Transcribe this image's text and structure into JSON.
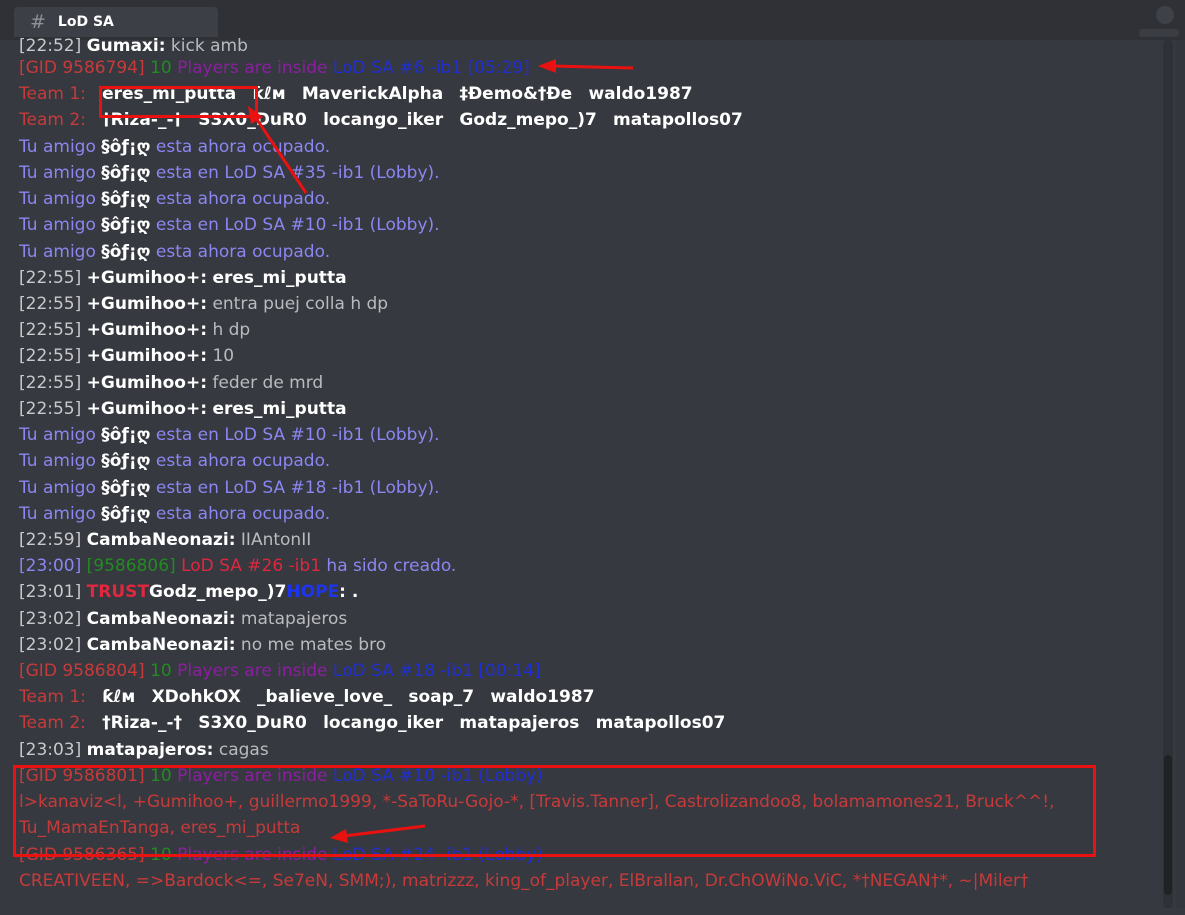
{
  "tab": {
    "icon": "hash-icon",
    "label": "LoD SA"
  },
  "chat": {
    "line0": {
      "time": "[22:52]",
      "user": "Gumaxi:",
      "text": "kick amb"
    },
    "gid1": {
      "gid": "[GID 9586794]",
      "count": "10",
      "status": "Players are inside",
      "game": "LoD SA #6 -ib1",
      "time": "[05:29]"
    },
    "team1a": {
      "label": "Team 1:",
      "players": [
        "eres_mi_putta",
        "ƙℓм",
        "MaverickAlpha",
        "‡Ðemo&†Ðe",
        "waldo1987"
      ]
    },
    "team2a": {
      "label": "Team 2:",
      "players": [
        "†Riza-_-†",
        "S3X0_DuR0",
        "locango_iker",
        "Godz_mepo_)7",
        "matapollos07"
      ]
    },
    "friend": "§ôƒ¡ღ",
    "friend_prefix": "Tu amigo",
    "busy_text": "esta ahora ocupado.",
    "lobby35": "esta en LoD SA #35 -ib1 (Lobby).",
    "lobby10": "esta en LoD SA #10 -ib1 (Lobby).",
    "lobby18": "esta en LoD SA #18 -ib1 (Lobby).",
    "msgs1": [
      {
        "time": "[22:55]",
        "user": "+Gumihoo+:",
        "text": "eres_mi_putta",
        "bold": true
      },
      {
        "time": "[22:55]",
        "user": "+Gumihoo+:",
        "text": "entra puej colla h dp"
      },
      {
        "time": "[22:55]",
        "user": "+Gumihoo+:",
        "text": "h dp"
      },
      {
        "time": "[22:55]",
        "user": "+Gumihoo+:",
        "text": "10"
      },
      {
        "time": "[22:55]",
        "user": "+Gumihoo+:",
        "text": "feder de mrd"
      },
      {
        "time": "[22:55]",
        "user": "+Gumihoo+:",
        "text": "eres_mi_putta",
        "bold": true
      }
    ],
    "m2259": {
      "time": "[22:59]",
      "user": "CambaNeonazi:",
      "text": "IIAntonII"
    },
    "created": {
      "time": "[23:00]",
      "gid": "[9586806]",
      "game": "LoD SA #26 -ib1",
      "text": "ha sido creado."
    },
    "trust": {
      "time": "[23:01]",
      "pre": "TRUST",
      "name": "Godz_mepo_)7",
      "post": "HOPE",
      "text": ": ."
    },
    "m2302a": {
      "time": "[23:02]",
      "user": "CambaNeonazi:",
      "text": "matapajeros"
    },
    "m2302b": {
      "time": "[23:02]",
      "user": "CambaNeonazi:",
      "text": "no me mates bro"
    },
    "gid2": {
      "gid": "[GID 9586804]",
      "count": "10",
      "status": "Players are inside",
      "game": "LoD SA #18 -ib1",
      "time": "[00:14]"
    },
    "team1b": {
      "label": "Team 1:",
      "players": [
        "ƙℓм",
        "XDohkOX",
        "_balieve_love_",
        "soap_7",
        "waldo1987"
      ]
    },
    "team2b": {
      "label": "Team 2:",
      "players": [
        "†Riza-_-†",
        "S3X0_DuR0",
        "locango_iker",
        "matapajeros",
        "matapollos07"
      ]
    },
    "m2303": {
      "time": "[23:03]",
      "user": "matapajeros:",
      "text": "cagas"
    },
    "gid3": {
      "gid": "[GID 9586801]",
      "count": "10",
      "status": "Players are inside",
      "game": "LoD SA #10 -ib1 (Lobby)"
    },
    "list3a": "l>kanaviz<l, +Gumihoo+, guillermo1999, *-SaToRu-Gojo-*, [Travis.Tanner], Castrolizandoo8, bolamamones21, Bruck^^!,",
    "list3b": "Tu_MamaEnTanga, eres_mi_putta",
    "gid4": {
      "gid": "[GID 9586365]",
      "count": "10",
      "status": "Players are inside",
      "game": "LoD SA #24 -ib1 (Lobby)"
    },
    "list4": "CREATIVEEN, =>Bardock<=, Se7eN, SMM;), matrizzz, king_of_player, ElBrallan, Dr.ChOWiNo.ViC, *†NEGAN†*, ~|Miler†"
  },
  "colors": {
    "annotation": "#ea1111",
    "background": "#36393f"
  }
}
